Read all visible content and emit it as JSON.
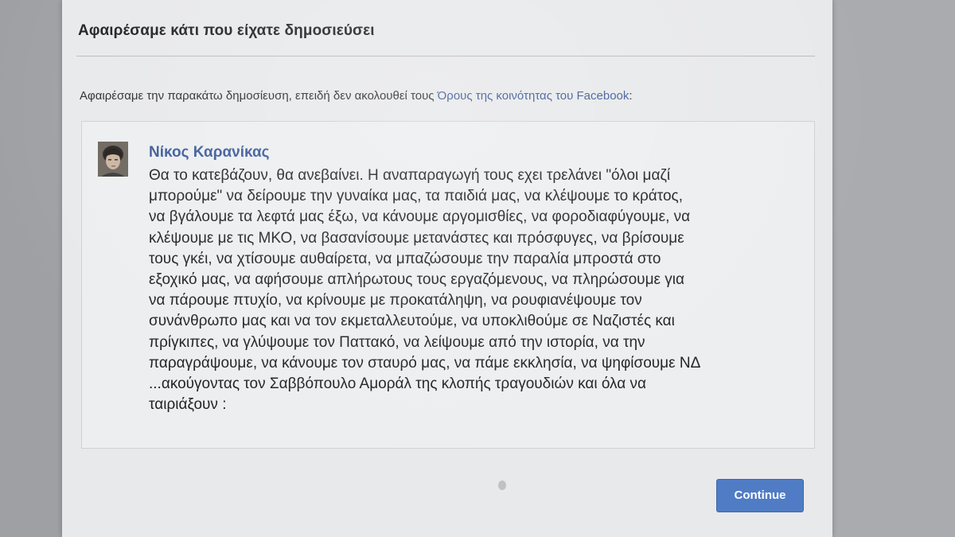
{
  "dialog": {
    "title": "Αφαιρέσαμε κάτι που είχατε δημοσιεύσει",
    "intro_text": "Αφαιρέσαμε την παρακάτω δημοσίευση, επειδή δεν ακολουθεί τους ",
    "intro_link": "Όρους της κοινότητας του Facebook",
    "intro_suffix": ":",
    "continue_label": "Continue"
  },
  "post": {
    "author": "Νίκος Καρανίκας",
    "lines": [
      "Θα το κατεβάζουν, θα ανεβαίνει. Η αναπαραγωγή τους εχει τρελάνει \"όλοι μαζί",
      "μπορούμε\" να δείρουμε την γυναίκα μας, τα παιδιά μας, να κλέψουμε το κράτος,",
      "να βγάλουμε τα λεφτά μας έξω, να κάνουμε αργομισθίες, να φοροδιαφύγουμε, να",
      "κλέψουμε με τις ΜΚΟ, να βασανίσουμε μετανάστες και πρόσφυγες, να βρίσουμε",
      "τους γκέι, να χτίσουμε αυθαίρετα, να μπαζώσουμε την παραλία μπροστά στο",
      "εξοχικό μας, να αφήσουμε απλήρωτους τους εργαζόμενους, να πληρώσουμε για",
      "να πάρουμε πτυχίο, να κρίνουμε με προκατάληψη, να ρουφιανέψουμε τον",
      "συνάνθρωπο μας και να τον εκμεταλλευτούμε, να υποκλιθούμε σε Ναζιστές και",
      "πρίγκιπες, να γλύψουμε τον Παττακό, να λείψουμε από την ιστορία, να την",
      "παραγράψουμε, να κάνουμε τον σταυρό μας, να πάμε εκκλησία, να ψηφίσουμε ΝΔ",
      "...ακούγοντας τον Σαββόπουλο Αμοράλ της κλοπής τραγουδιών και όλα να",
      "ταιριάξουν :"
    ]
  },
  "colors": {
    "link": "#3b5998",
    "button": "#4f7cc4"
  }
}
